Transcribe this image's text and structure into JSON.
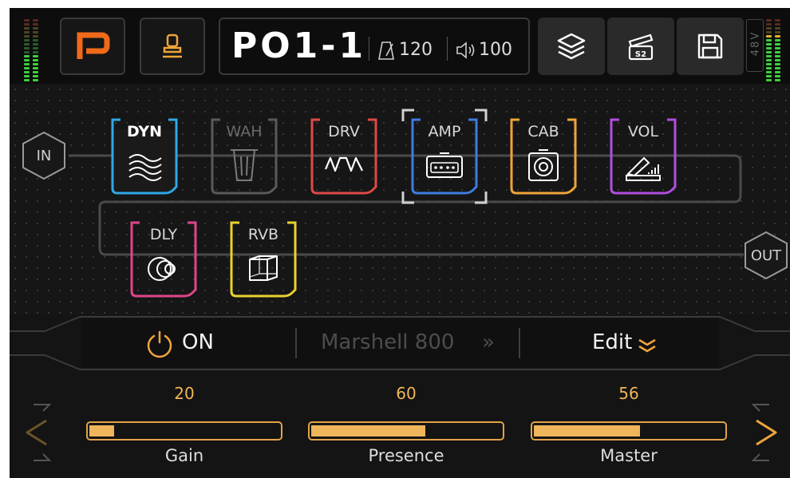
{
  "topbar": {
    "preset_name": "PO1-1",
    "tempo_value": "120",
    "volume_value": "100",
    "icons": [
      "p-logo-icon",
      "stamp-icon",
      "layers-icon",
      "scene-icon",
      "save-icon"
    ],
    "phantom_label": "48V",
    "scene_badge": "S2"
  },
  "chain": {
    "input_label": "IN",
    "output_label": "OUT",
    "blocks": [
      {
        "label": "DYN",
        "color": "#2fa8e8",
        "state": "on",
        "icon": "waves-icon"
      },
      {
        "label": "WAH",
        "color": "#6a6a6a",
        "state": "off",
        "icon": "wah-pedal-icon"
      },
      {
        "label": "DRV",
        "color": "#e04848",
        "state": "on",
        "icon": "square-wave-icon"
      },
      {
        "label": "AMP",
        "color": "#3d7de0",
        "state": "selected",
        "icon": "amp-head-icon"
      },
      {
        "label": "CAB",
        "color": "#f0a43a",
        "state": "on",
        "icon": "speaker-cab-icon"
      },
      {
        "label": "VOL",
        "color": "#b24ee0",
        "state": "on",
        "icon": "volume-pedal-icon"
      },
      {
        "label": "DLY",
        "color": "#e0458a",
        "state": "on",
        "icon": "delay-circles-icon"
      },
      {
        "label": "RVB",
        "color": "#e8d230",
        "state": "on",
        "icon": "cube-icon"
      }
    ]
  },
  "controls": {
    "power_label": "ON",
    "model_name": "Marshell 800",
    "model_arrow": "»",
    "edit_label": "Edit"
  },
  "params": [
    {
      "name": "Gain",
      "value": "20",
      "level": 0.13
    },
    {
      "name": "Presence",
      "value": "60",
      "level": 0.6
    },
    {
      "name": "Master",
      "value": "56",
      "level": 0.56
    }
  ],
  "colors": {
    "accent_orange": "#f0a43a",
    "logo_orange": "#f06a1a"
  }
}
